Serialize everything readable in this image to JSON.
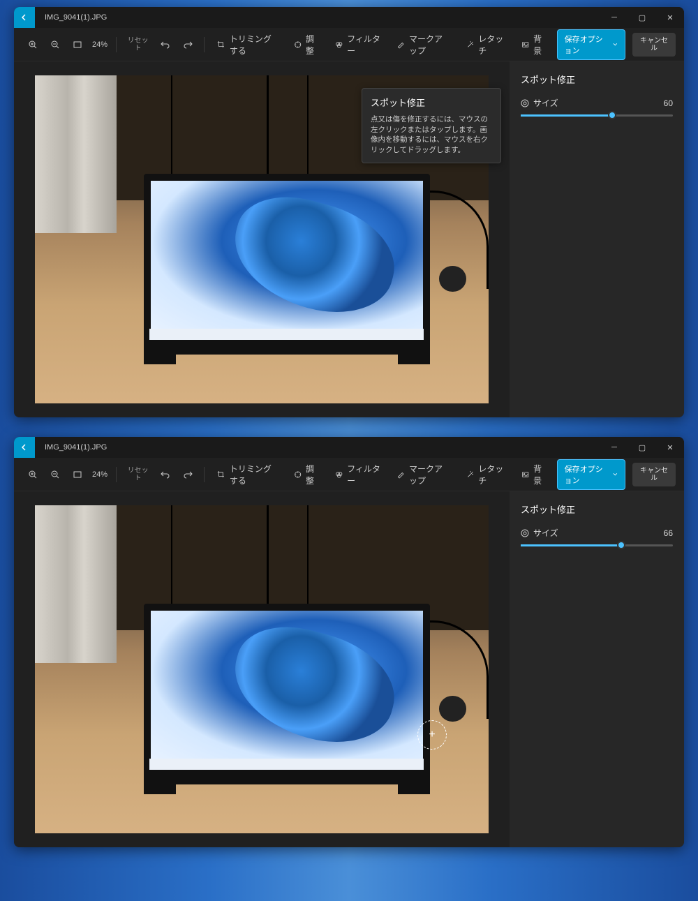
{
  "window1": {
    "title": "IMG_9041(1).JPG",
    "zoom": "24%",
    "reset": "リセット",
    "tabs": {
      "crop": "トリミングする",
      "adjust": "調整",
      "filter": "フィルター",
      "markup": "マークアップ",
      "retouch": "レタッチ",
      "background": "背景"
    },
    "save_options": "保存オプション",
    "cancel": "キャンセル",
    "panel": {
      "title": "スポット修正",
      "size_label": "サイズ",
      "size_value": "60",
      "slider_pct": 60
    },
    "tooltip": {
      "title": "スポット修正",
      "body": "点又は傷を修正するには、マウスの左クリックまたはタップします。画像内を移動するには、マウスを右クリックしてドラッグします。"
    }
  },
  "window2": {
    "title": "IMG_9041(1).JPG",
    "zoom": "24%",
    "reset": "リセット",
    "tabs": {
      "crop": "トリミングする",
      "adjust": "調整",
      "filter": "フィルター",
      "markup": "マークアップ",
      "retouch": "レタッチ",
      "background": "背景"
    },
    "save_options": "保存オプション",
    "cancel": "キャンセル",
    "panel": {
      "title": "スポット修正",
      "size_label": "サイズ",
      "size_value": "66",
      "slider_pct": 66
    }
  }
}
